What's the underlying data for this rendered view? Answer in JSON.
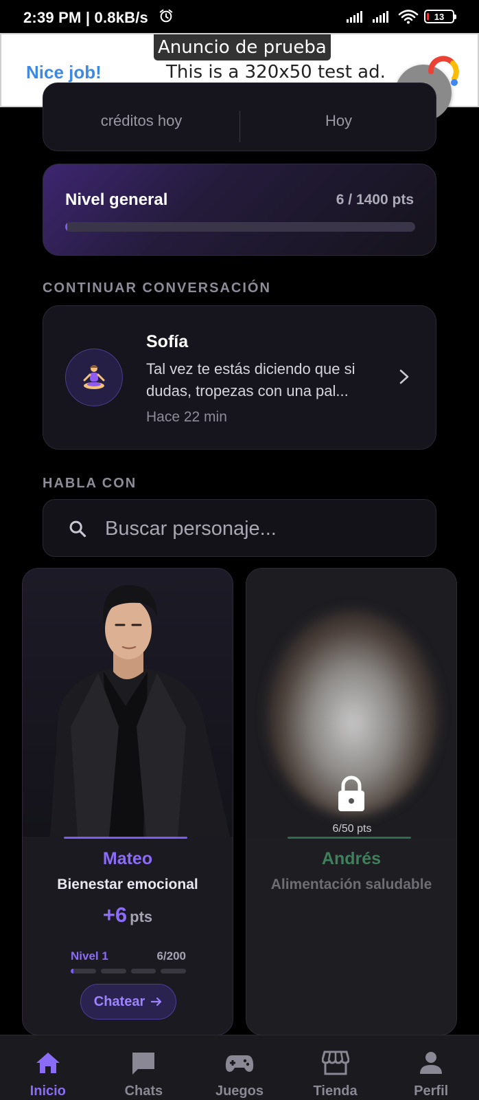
{
  "status_bar": {
    "time": "2:39 PM | 0.8kB/s",
    "battery": "13"
  },
  "ad": {
    "label": "Anuncio de prueba",
    "headline": "Nice job!",
    "text": "This is a 320x50 test ad."
  },
  "stats": {
    "left_label": "créditos hoy",
    "right_label": "Hoy"
  },
  "level": {
    "title": "Nivel general",
    "points": "6 / 1400 pts",
    "progress": 0.004
  },
  "continue_section": {
    "label": "CONTINUAR CONVERSACIÓN",
    "name": "Sofía",
    "avatar_icon": "meditation-person-icon",
    "preview": "Tal vez te estás diciendo que si dudas, tropezas con una pal...",
    "time": "Hace 22 min"
  },
  "talk_section": {
    "label": "HABLA CON",
    "search_placeholder": "Buscar personaje..."
  },
  "characters": [
    {
      "name": "Mateo",
      "role": "Bienestar emocional",
      "points_value": "+6",
      "points_unit": "pts",
      "level": "Nivel 1",
      "level_count": "6/200",
      "level_progress": 0.03,
      "button": "Chatear",
      "locked": false,
      "accent": "#8b6cf6"
    },
    {
      "name": "Andrés",
      "role": "Alimentación saludable",
      "lock_points": "6/50 pts",
      "locked": true,
      "accent": "#3f7f5c"
    }
  ],
  "nav": {
    "items": [
      {
        "label": "Inicio",
        "icon": "home-icon",
        "active": true
      },
      {
        "label": "Chats",
        "icon": "chat-icon",
        "active": false
      },
      {
        "label": "Juegos",
        "icon": "gamepad-icon",
        "active": false
      },
      {
        "label": "Tienda",
        "icon": "store-icon",
        "active": false
      },
      {
        "label": "Perfil",
        "icon": "person-icon",
        "active": false
      }
    ]
  },
  "colors": {
    "accent": "#7b5cf5",
    "background": "#000000",
    "card": "#16141d"
  }
}
